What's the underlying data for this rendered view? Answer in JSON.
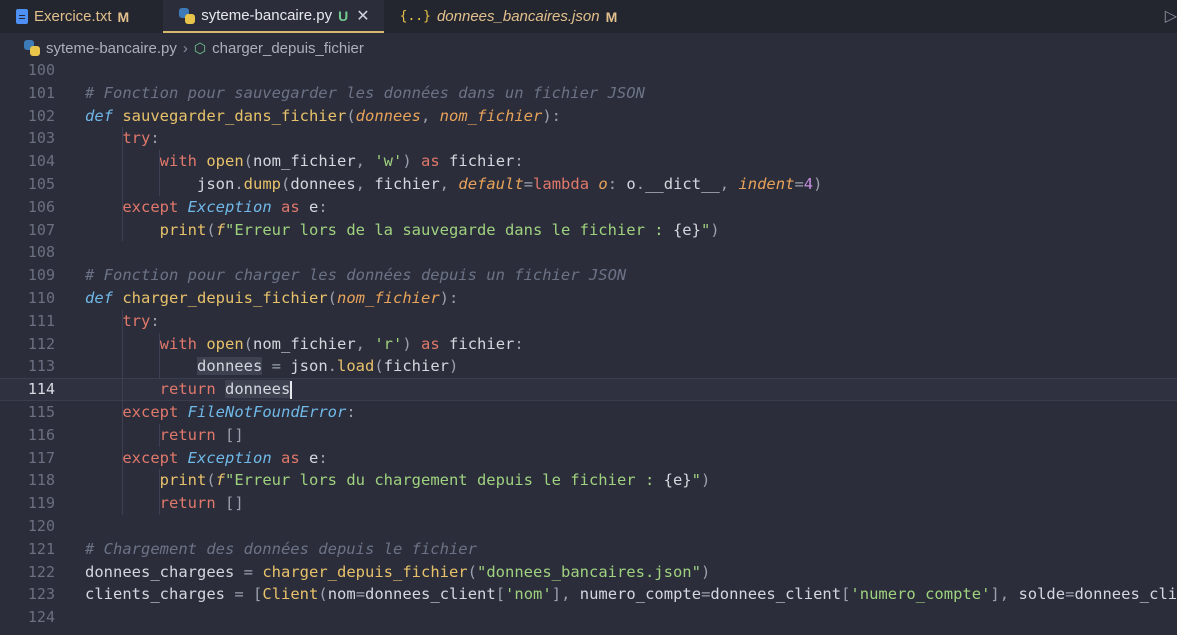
{
  "tabs": [
    {
      "name": "Exercice.txt",
      "status": "M",
      "icon": "text-file-icon"
    },
    {
      "name": "syteme-bancaire.py",
      "status": "U",
      "icon": "python-icon",
      "active": true
    },
    {
      "name": "donnees_bancaires.json",
      "status": "M",
      "icon": "json-icon"
    }
  ],
  "breadcrumb": {
    "file": "syteme-bancaire.py",
    "symbol": "charger_depuis_fichier"
  },
  "colors": {
    "background": "#2b2d3a",
    "keyword": "#e0786b",
    "function": "#e8c26a",
    "string": "#9fd27f",
    "comment": "#6c7386"
  },
  "editor": {
    "current_line": 114,
    "lines": [
      {
        "n": "100",
        "text": ""
      },
      {
        "n": "101",
        "text": "# Fonction pour sauvegarder les données dans un fichier JSON"
      },
      {
        "n": "102",
        "text": "def sauvegarder_dans_fichier(donnees, nom_fichier):"
      },
      {
        "n": "103",
        "text": "    try:"
      },
      {
        "n": "104",
        "text": "        with open(nom_fichier, 'w') as fichier:"
      },
      {
        "n": "105",
        "text": "            json.dump(donnees, fichier, default=lambda o: o.__dict__, indent=4)"
      },
      {
        "n": "106",
        "text": "    except Exception as e:"
      },
      {
        "n": "107",
        "text": "        print(f\"Erreur lors de la sauvegarde dans le fichier : {e}\")"
      },
      {
        "n": "108",
        "text": ""
      },
      {
        "n": "109",
        "text": "# Fonction pour charger les données depuis un fichier JSON"
      },
      {
        "n": "110",
        "text": "def charger_depuis_fichier(nom_fichier):"
      },
      {
        "n": "111",
        "text": "    try:"
      },
      {
        "n": "112",
        "text": "        with open(nom_fichier, 'r') as fichier:"
      },
      {
        "n": "113",
        "text": "            donnees = json.load(fichier)"
      },
      {
        "n": "114",
        "text": "        return donnees"
      },
      {
        "n": "115",
        "text": "    except FileNotFoundError:"
      },
      {
        "n": "116",
        "text": "        return []"
      },
      {
        "n": "117",
        "text": "    except Exception as e:"
      },
      {
        "n": "118",
        "text": "        print(f\"Erreur lors du chargement depuis le fichier : {e}\")"
      },
      {
        "n": "119",
        "text": "        return []"
      },
      {
        "n": "120",
        "text": ""
      },
      {
        "n": "121",
        "text": "# Chargement des données depuis le fichier"
      },
      {
        "n": "122",
        "text": "donnees_chargees = charger_depuis_fichier(\"donnees_bancaires.json\")"
      },
      {
        "n": "123",
        "text": "clients_charges = [Client(nom=donnees_client['nom'], numero_compte=donnees_client['numero_compte'], solde=donnees_clie"
      },
      {
        "n": "124",
        "text": ""
      }
    ]
  }
}
